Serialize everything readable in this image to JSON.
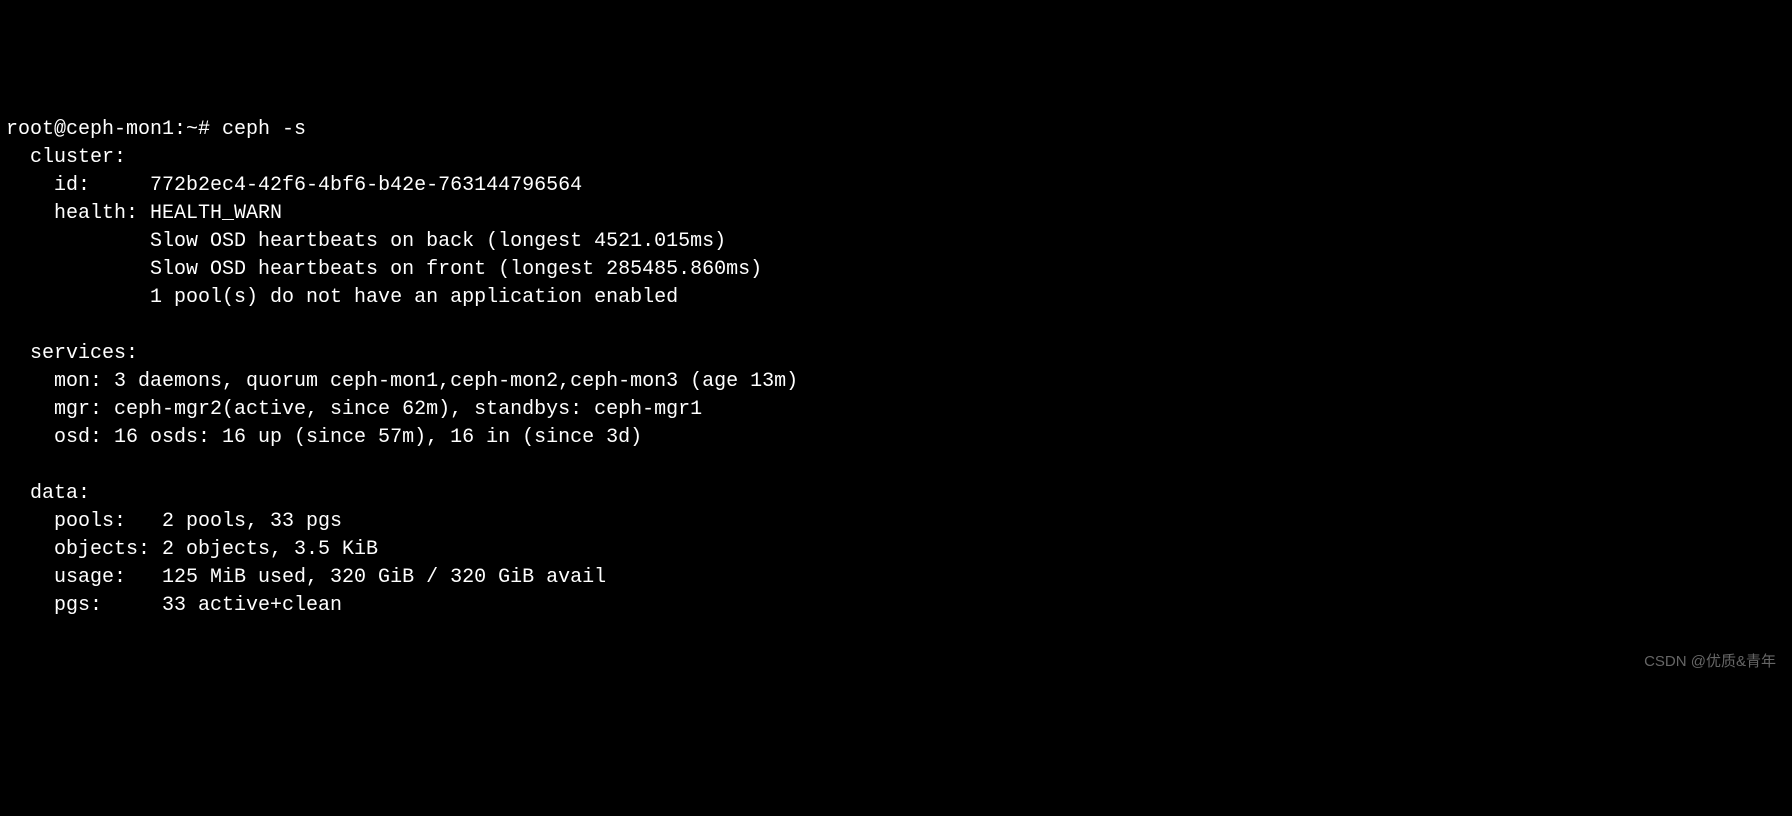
{
  "prompt": "root@ceph-mon1:~# ",
  "command": "ceph -s",
  "cluster": {
    "header": "  cluster:",
    "id_label": "    id:     ",
    "id_value": "772b2ec4-42f6-4bf6-b42e-763144796564",
    "health_label": "    health: ",
    "health_value": "HEALTH_WARN",
    "warn1": "            Slow OSD heartbeats on back (longest 4521.015ms)",
    "warn2": "            Slow OSD heartbeats on front (longest 285485.860ms)",
    "warn3": "            1 pool(s) do not have an application enabled"
  },
  "services": {
    "header": "  services:",
    "mon": "    mon: 3 daemons, quorum ceph-mon1,ceph-mon2,ceph-mon3 (age 13m)",
    "mgr": "    mgr: ceph-mgr2(active, since 62m), standbys: ceph-mgr1",
    "osd": "    osd: 16 osds: 16 up (since 57m), 16 in (since 3d)"
  },
  "data": {
    "header": "  data:",
    "pools": "    pools:   2 pools, 33 pgs",
    "objects": "    objects: 2 objects, 3.5 KiB",
    "usage": "    usage:   125 MiB used, 320 GiB / 320 GiB avail",
    "pgs": "    pgs:     33 active+clean"
  },
  "watermark": "CSDN @优质&青年"
}
